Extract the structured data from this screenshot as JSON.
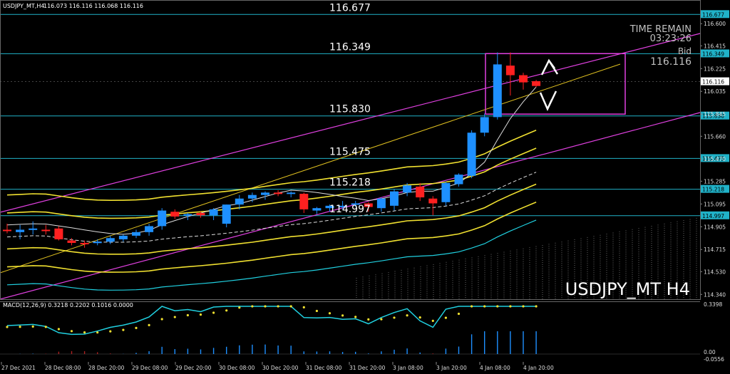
{
  "header": {
    "symbol": "USDJPY_MT,H4",
    "ohlc": "116.073 116.116 116.068 116.116"
  },
  "chart_data": {
    "type": "candlestick",
    "symbol_label": "USDJPY_MT H4",
    "ylim": [
      114.3,
      116.75
    ],
    "price_ticks": [
      "116.600",
      "116.415",
      "116.225",
      "116.035",
      "115.845",
      "115.660",
      "115.470",
      "115.285",
      "115.095",
      "114.905",
      "114.715",
      "114.530",
      "114.340"
    ],
    "x_ticks": [
      "27 Dec 2021",
      "28 Dec 08:00",
      "28 Dec 20:00",
      "29 Dec 08:00",
      "29 Dec 20:00",
      "30 Dec 08:00",
      "30 Dec 20:00",
      "31 Dec 08:00",
      "31 Dec 20:00",
      "3 Jan 08:00",
      "3 Jan 20:00",
      "4 Jan 08:00",
      "4 Jan 20:00"
    ],
    "levels": [
      {
        "value": 116.677,
        "label": "116.677"
      },
      {
        "value": 116.349,
        "label": "116.349"
      },
      {
        "value": 115.83,
        "label": "115.830"
      },
      {
        "value": 115.475,
        "label": "115.475"
      },
      {
        "value": 115.218,
        "label": "115.218"
      },
      {
        "value": 114.997,
        "label": "114.997"
      }
    ],
    "current_price": 116.116,
    "current_label": "116.116",
    "timer": {
      "label": "TIME REMAIN",
      "value": "03:23:26",
      "bid_label": "Bid",
      "bid_value": "116.116"
    },
    "candles": [
      {
        "o": 114.88,
        "h": 114.93,
        "l": 114.85,
        "c": 114.87
      },
      {
        "o": 114.86,
        "h": 114.92,
        "l": 114.8,
        "c": 114.88
      },
      {
        "o": 114.88,
        "h": 114.95,
        "l": 114.84,
        "c": 114.89
      },
      {
        "o": 114.88,
        "h": 114.92,
        "l": 114.84,
        "c": 114.87
      },
      {
        "o": 114.89,
        "h": 114.91,
        "l": 114.79,
        "c": 114.8
      },
      {
        "o": 114.79,
        "h": 114.81,
        "l": 114.75,
        "c": 114.77
      },
      {
        "o": 114.77,
        "h": 114.79,
        "l": 114.73,
        "c": 114.76
      },
      {
        "o": 114.77,
        "h": 114.8,
        "l": 114.75,
        "c": 114.78
      },
      {
        "o": 114.78,
        "h": 114.83,
        "l": 114.76,
        "c": 114.81
      },
      {
        "o": 114.8,
        "h": 114.84,
        "l": 114.78,
        "c": 114.83
      },
      {
        "o": 114.83,
        "h": 114.88,
        "l": 114.81,
        "c": 114.86
      },
      {
        "o": 114.86,
        "h": 114.93,
        "l": 114.83,
        "c": 114.91
      },
      {
        "o": 114.91,
        "h": 115.06,
        "l": 114.88,
        "c": 115.04
      },
      {
        "o": 115.03,
        "h": 115.05,
        "l": 114.97,
        "c": 114.99
      },
      {
        "o": 115.0,
        "h": 115.02,
        "l": 114.96,
        "c": 115.01
      },
      {
        "o": 115.02,
        "h": 115.03,
        "l": 114.98,
        "c": 115.0
      },
      {
        "o": 115.0,
        "h": 115.06,
        "l": 114.96,
        "c": 115.05
      },
      {
        "o": 114.93,
        "h": 115.09,
        "l": 114.9,
        "c": 115.09
      },
      {
        "o": 115.09,
        "h": 115.17,
        "l": 115.05,
        "c": 115.14
      },
      {
        "o": 115.14,
        "h": 115.19,
        "l": 115.11,
        "c": 115.17
      },
      {
        "o": 115.17,
        "h": 115.2,
        "l": 115.13,
        "c": 115.19
      },
      {
        "o": 115.19,
        "h": 115.21,
        "l": 115.16,
        "c": 115.18
      },
      {
        "o": 115.18,
        "h": 115.2,
        "l": 115.15,
        "c": 115.19
      },
      {
        "o": 115.18,
        "h": 115.19,
        "l": 115.02,
        "c": 115.05
      },
      {
        "o": 115.04,
        "h": 115.07,
        "l": 115.01,
        "c": 115.06
      },
      {
        "o": 115.06,
        "h": 115.09,
        "l": 115.03,
        "c": 115.08
      },
      {
        "o": 115.07,
        "h": 115.12,
        "l": 115.05,
        "c": 115.08
      },
      {
        "o": 115.09,
        "h": 115.12,
        "l": 115.07,
        "c": 115.1
      },
      {
        "o": 115.1,
        "h": 115.11,
        "l": 115.03,
        "c": 115.07
      },
      {
        "o": 115.06,
        "h": 115.15,
        "l": 115.03,
        "c": 115.14
      },
      {
        "o": 115.08,
        "h": 115.22,
        "l": 115.04,
        "c": 115.2
      },
      {
        "o": 115.19,
        "h": 115.27,
        "l": 115.16,
        "c": 115.25
      },
      {
        "o": 115.24,
        "h": 115.27,
        "l": 115.12,
        "c": 115.15
      },
      {
        "o": 115.14,
        "h": 115.16,
        "l": 115.0,
        "c": 115.1
      },
      {
        "o": 115.11,
        "h": 115.28,
        "l": 115.08,
        "c": 115.27
      },
      {
        "o": 115.26,
        "h": 115.35,
        "l": 115.24,
        "c": 115.34
      },
      {
        "o": 115.33,
        "h": 115.71,
        "l": 115.31,
        "c": 115.69
      },
      {
        "o": 115.69,
        "h": 115.85,
        "l": 115.66,
        "c": 115.82
      },
      {
        "o": 115.82,
        "h": 116.36,
        "l": 115.8,
        "c": 116.26
      },
      {
        "o": 116.25,
        "h": 116.36,
        "l": 116.0,
        "c": 116.17
      },
      {
        "o": 116.17,
        "h": 116.19,
        "l": 116.05,
        "c": 116.11
      },
      {
        "o": 116.12,
        "h": 116.13,
        "l": 116.07,
        "c": 116.08
      }
    ],
    "macd": {
      "label": "MACD(12,26,9) 0.3218 0.2202 0.1016 0.0000",
      "ticks": [
        "0.3398",
        "0.00",
        "-0.0556"
      ]
    }
  }
}
